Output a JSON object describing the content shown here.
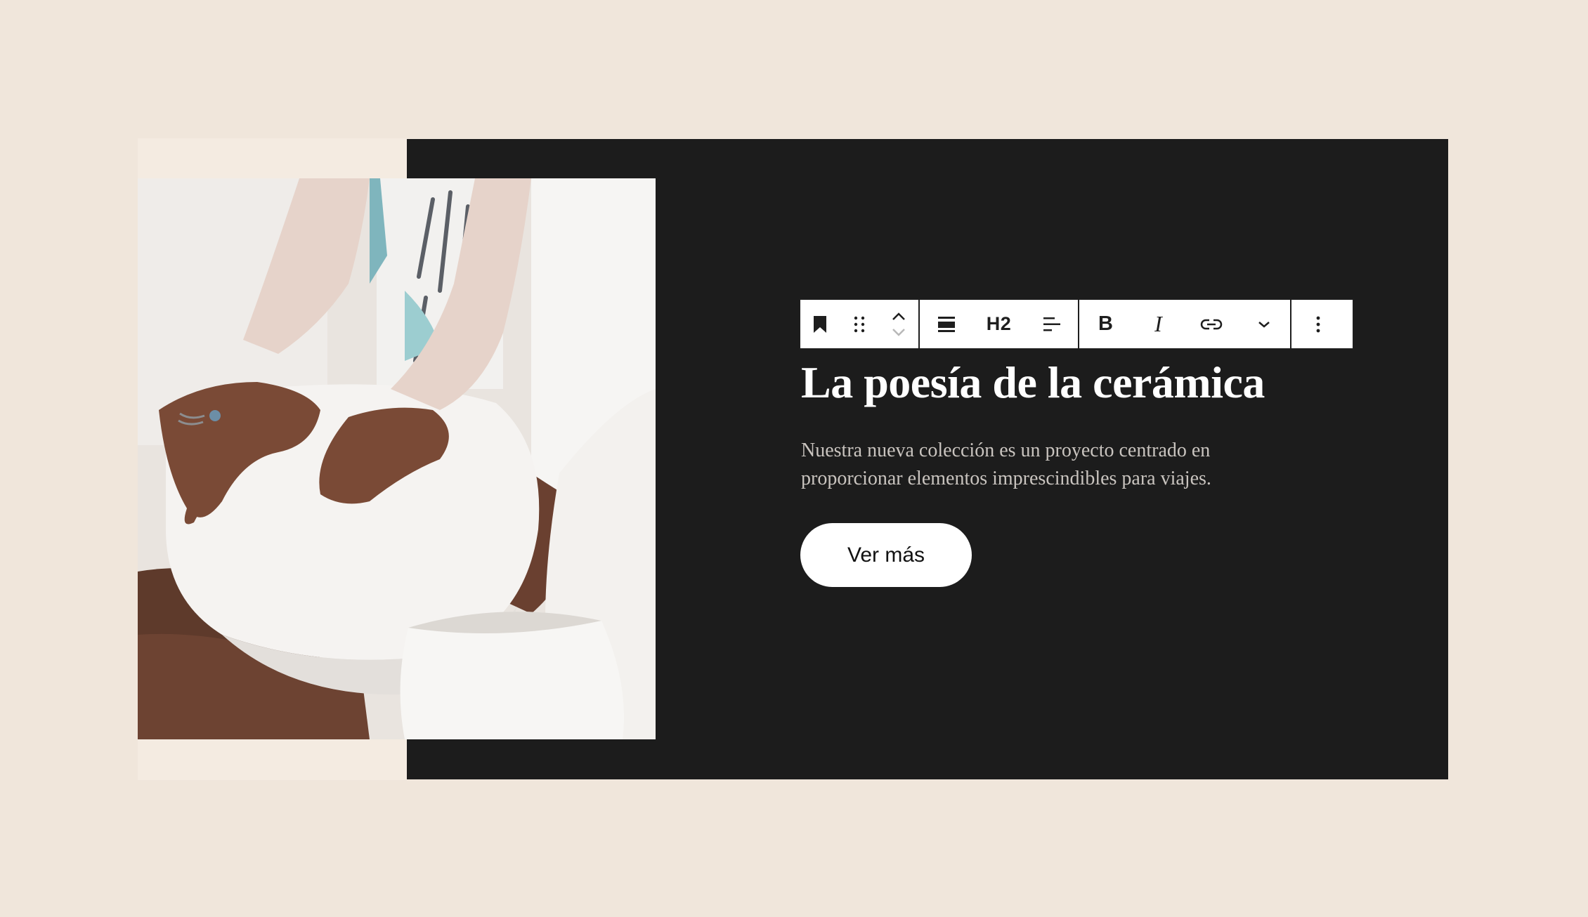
{
  "toolbar": {
    "block_icon": "bookmark-icon",
    "drag_icon": "drag-handle-icon",
    "move_up_icon": "chevron-up-icon",
    "move_down_icon": "chevron-down-icon",
    "align_icon": "align-full-width-icon",
    "heading_level": "H2",
    "text_align_icon": "align-left-icon",
    "bold_label": "B",
    "italic_label": "I",
    "link_icon": "link-icon",
    "more_formats_icon": "chevron-down-icon",
    "options_icon": "more-vertical-icon"
  },
  "cover": {
    "heading": "La poesía de la cerámica",
    "description": "Nuestra nueva colección es un proyecto centrado en proporcionar elementos imprescindibles para viajes.",
    "button_label": "Ver más"
  },
  "colors": {
    "page_background": "#f0e6db",
    "cover_background": "#1c1c1c",
    "heading_text": "#ffffff",
    "description_text": "#c9c4bf",
    "button_background": "#ffffff"
  }
}
